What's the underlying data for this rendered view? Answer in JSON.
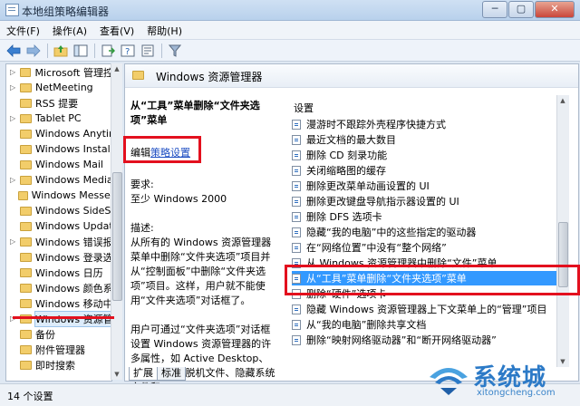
{
  "window": {
    "title": "本地组策略编辑器",
    "minimize": "─",
    "maximize": "▢",
    "close": "✕"
  },
  "menu": [
    "文件(F)",
    "操作(A)",
    "查看(V)",
    "帮助(H)"
  ],
  "toolbar": {
    "back_icon": "arrow-left-icon",
    "forward_icon": "arrow-right-icon",
    "up_icon": "folder-up-icon",
    "show_hide_icon": "console-tree-icon",
    "export_icon": "export-icon",
    "help_icon": "help-icon",
    "properties_icon": "properties-icon",
    "filter_icon": "filter-icon"
  },
  "tree": {
    "items": [
      "Microsoft 管理控制台",
      "NetMeeting",
      "RSS 提要",
      "Tablet PC",
      "Windows Anytime",
      "Windows Installer",
      "Windows Mail",
      "Windows Media",
      "Windows Messenger",
      "Windows SideShow",
      "Windows Update",
      "Windows 错误报告",
      "Windows 登录选项",
      "Windows 日历",
      "Windows 颜色系统",
      "Windows 移动中心",
      "Windows 资源管理器",
      "备份",
      "附件管理器",
      "即时搜索"
    ],
    "selected_index": 16
  },
  "right_header": "Windows 资源管理器",
  "description": {
    "title": "从“工具”菜单删除“文件夹选项”菜单",
    "edit_prefix": "编辑",
    "edit_link": "策略设置",
    "req_label": "要求:",
    "req_value": "至少 Windows 2000",
    "desc_label": "描述:",
    "desc_text": "从所有的 Windows 资源管理器菜单中删除“文件夹选项”项目并从“控制面板”中删除“文件夹选项”项目。这样，用户就不能使用“文件夹选项”对话框了。",
    "desc_text2": "用户可通过“文件夹选项”对话框设置 Windows 资源管理器的许多属性，如 Active Desktop、Web 视图、脱机文件、隐藏系统文件和"
  },
  "list": {
    "header": "设置",
    "items": [
      "漫游时不跟踪外壳程序快捷方式",
      "最近文档的最大数目",
      "删除 CD 刻录功能",
      "关闭缩略图的缓存",
      "删除更改菜单动画设置的 UI",
      "删除更改键盘导航指示器设置的 UI",
      "删除 DFS 选项卡",
      "隐藏“我的电脑”中的这些指定的驱动器",
      "在“网络位置”中没有“整个网络”",
      "从 Windows 资源管理器中删除“文件”菜单",
      "从“工具”菜单删除“文件夹选项”菜单",
      "删除“硬件”选项卡",
      "隐藏 Windows 资源管理器上下文菜单上的“管理”项目",
      "从“我的电脑”删除共享文档",
      "删除“映射网络驱动器”和“断开网络驱动器”"
    ],
    "selected_index": 10
  },
  "tabs": [
    "扩展",
    "标准"
  ],
  "status": "14 个设置",
  "watermark": {
    "name": "系统城",
    "url": "xitongcheng.com"
  },
  "colors": {
    "selection": "#3399ff",
    "annotation_red": "#e3101e",
    "link": "#1f4fc3"
  }
}
